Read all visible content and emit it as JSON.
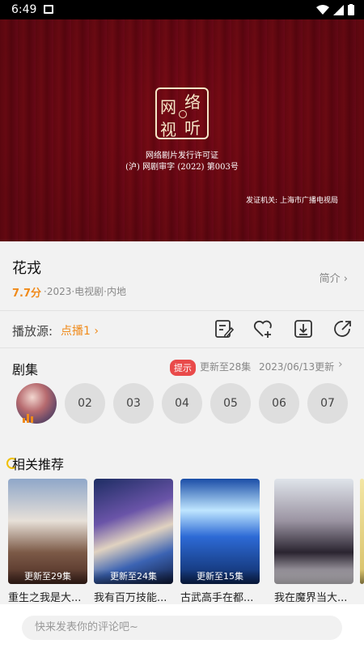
{
  "status": {
    "time": "6:49"
  },
  "video": {
    "seal_chars": [
      "网",
      "络",
      "视",
      "听"
    ],
    "license_line1": "网络剧片发行许可证",
    "license_line2": "(沪) 网剧审字 (2022) 第003号",
    "issuer": "发证机关: 上海市广播电视局"
  },
  "show": {
    "title": "花戎",
    "rating": "7.7分",
    "meta": "·2023·电视剧·内地",
    "intro_label": "简介 ›"
  },
  "source": {
    "label": "播放源:",
    "value": "点播1 ›",
    "tools": [
      "edit-note-icon",
      "heart-add-icon",
      "download-icon",
      "share-icon"
    ]
  },
  "episodes": {
    "title": "剧集",
    "badge": "提示",
    "update_text": "更新至28集",
    "date_text": "2023/06/13更新",
    "chevron": "›",
    "items": [
      "",
      "02",
      "03",
      "04",
      "05",
      "06",
      "07"
    ]
  },
  "recommend": {
    "title": "相关推荐",
    "cards": [
      {
        "overlay": "更新至29集",
        "caption": "重生之我是大..."
      },
      {
        "overlay": "更新至24集",
        "caption": "我有百万技能..."
      },
      {
        "overlay": "更新至15集",
        "caption": "古武高手在都..."
      },
      {
        "overlay": "",
        "caption": "我在魔界当大..."
      },
      {
        "overlay": "",
        "caption": ""
      }
    ]
  },
  "comment": {
    "placeholder": "快来发表你的评论吧~"
  },
  "colors": {
    "accent": "#f08a1a",
    "badge": "#e94a4a",
    "video_bg": "#6d0812"
  }
}
